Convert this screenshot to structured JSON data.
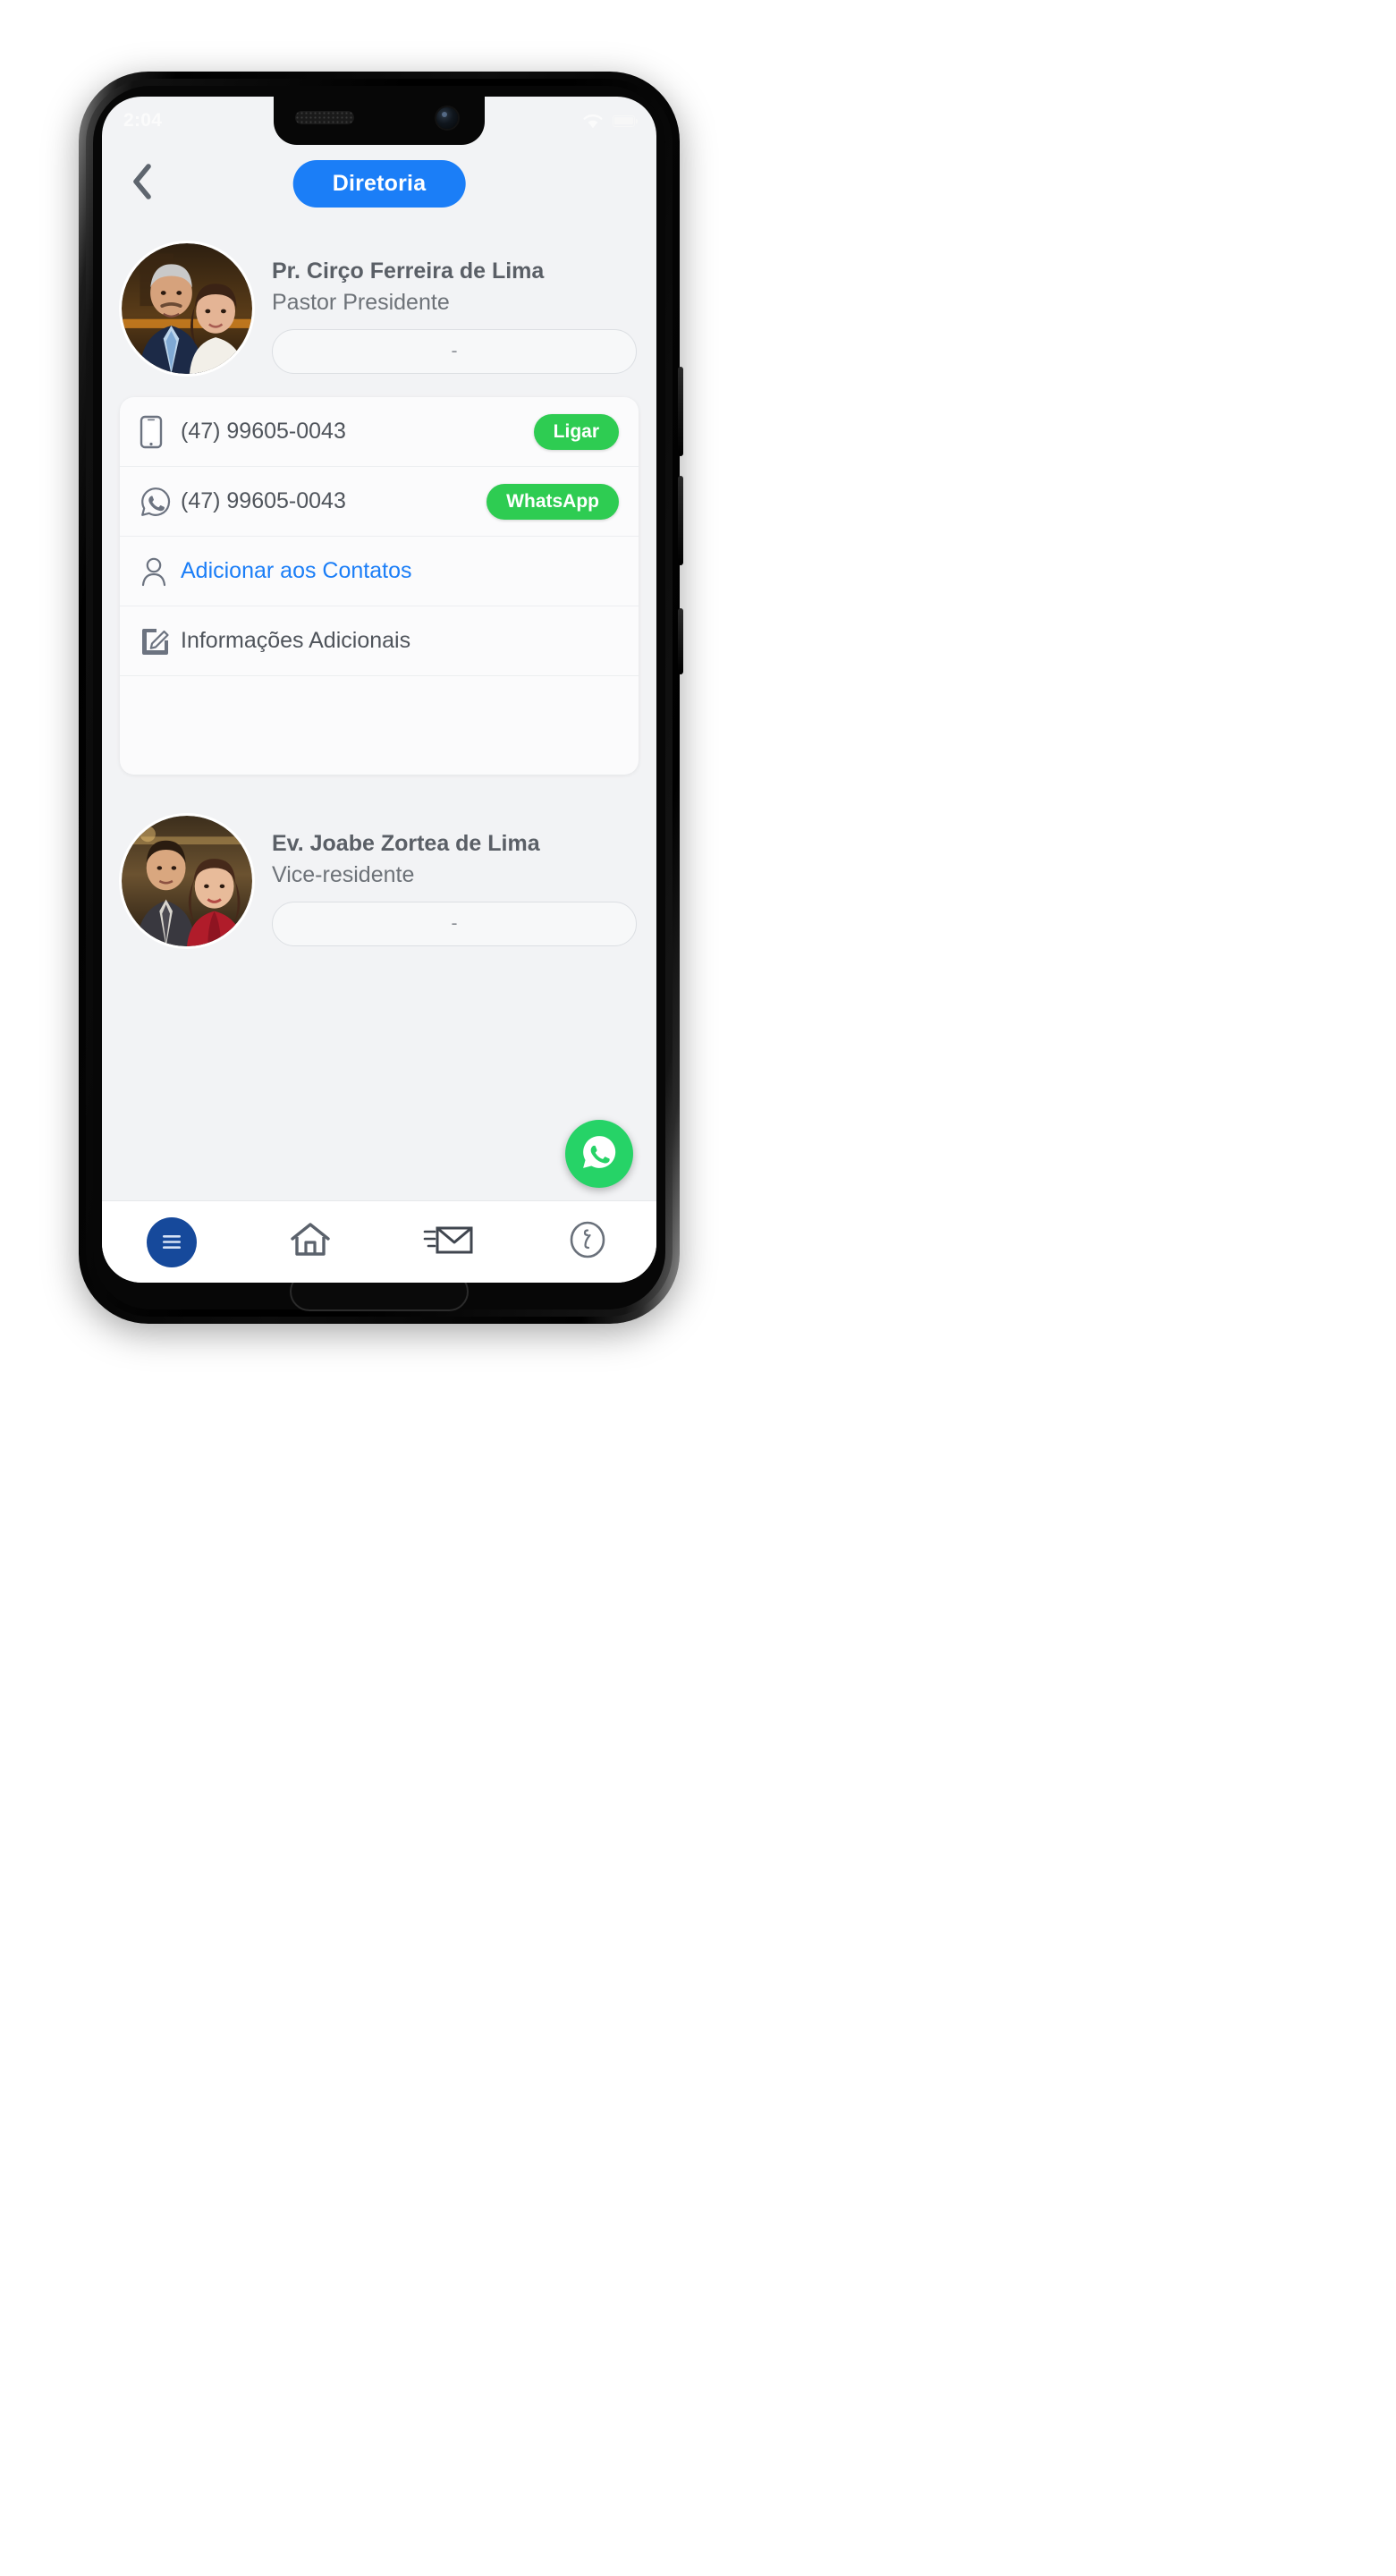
{
  "status_bar": {
    "time": "2:04",
    "wifi_icon": "wifi-icon",
    "battery_icon": "battery-icon"
  },
  "header": {
    "back_icon": "chevron-left-icon",
    "title": "Diretoria",
    "title_bg": "#1b7ef7"
  },
  "people": [
    {
      "name": "Pr. Cirço Ferreira de Lima",
      "role": "Pastor Presidente",
      "detail_placeholder": "-",
      "avatar_icon": "avatar-photo-couple-1"
    },
    {
      "name": "Ev. Joabe Zortea de Lima",
      "role": "Vice-residente",
      "detail_placeholder": "-",
      "avatar_icon": "avatar-photo-couple-2"
    }
  ],
  "contact_card": {
    "rows": [
      {
        "icon": "mobile-phone-icon",
        "label": "(47) 99605-0043",
        "action": "Ligar",
        "action_color": "#2ecc52",
        "is_link": false
      },
      {
        "icon": "whatsapp-icon",
        "label": "(47) 99605-0043",
        "action": "WhatsApp",
        "action_color": "#2ecc52",
        "is_link": false
      },
      {
        "icon": "person-add-icon",
        "label": "Adicionar aos Contatos",
        "action": "",
        "action_color": "",
        "is_link": true
      },
      {
        "icon": "edit-note-icon",
        "label": "Informações Adicionais",
        "action": "",
        "action_color": "",
        "is_link": false
      }
    ]
  },
  "fab": {
    "icon": "whatsapp-icon",
    "color": "#26d367"
  },
  "bottom_nav": {
    "items": [
      {
        "icon": "menu-hamburger-icon",
        "active": true
      },
      {
        "icon": "home-icon",
        "active": false
      },
      {
        "icon": "mail-envelope-icon",
        "active": false
      },
      {
        "icon": "info-icon",
        "active": false
      }
    ],
    "active_color": "#16499b"
  }
}
